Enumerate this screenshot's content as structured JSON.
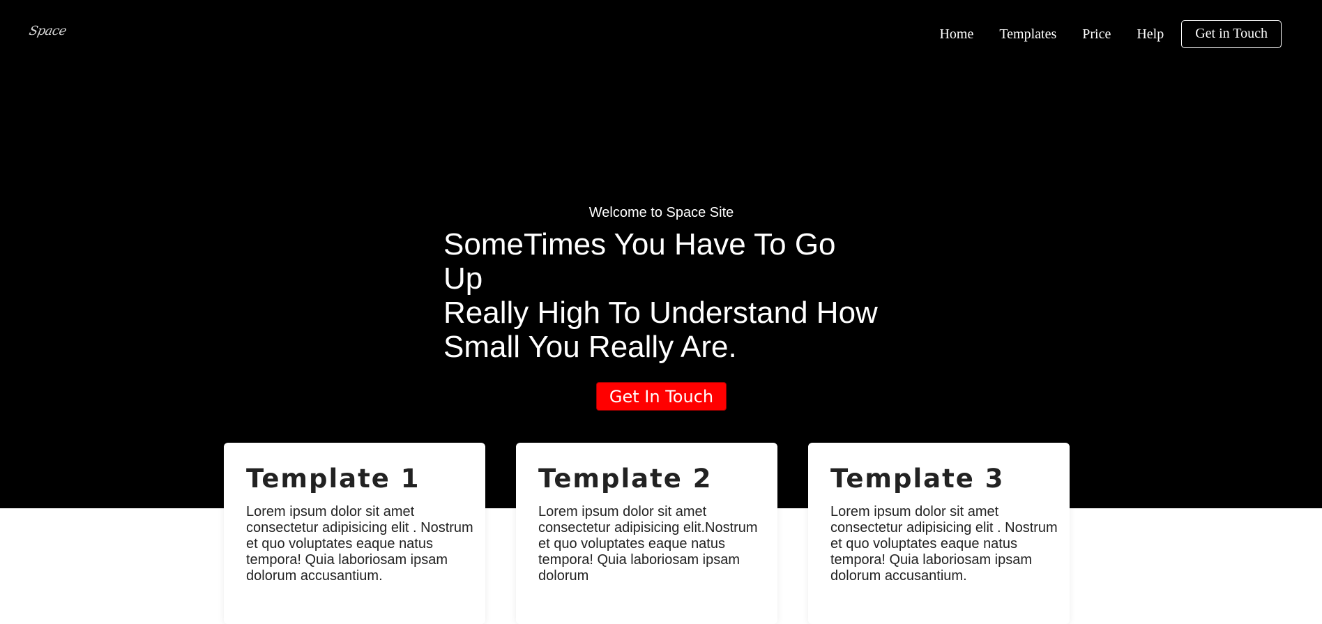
{
  "header": {
    "logo": "Space",
    "nav": {
      "home": "Home",
      "templates": "Templates",
      "price": "Price",
      "help": "Help",
      "get_in_touch": "Get in Touch"
    }
  },
  "hero": {
    "welcome": "Welcome to Space Site",
    "headline_line1": "SomeTimes You Have To Go Up",
    "headline_line2": "Really High To Understand How",
    "headline_line3": "Small You Really Are.",
    "cta": "Get In Touch"
  },
  "cards": [
    {
      "title": "Template 1",
      "text": "Lorem ipsum dolor sit amet consectetur adipisicing elit . Nostrum et quo voluptates eaque natus tempora! Quia laboriosam ipsam dolorum accusantium."
    },
    {
      "title": "Template 2",
      "text": "Lorem ipsum dolor sit amet consectetur adipisicing elit.Nostrum et quo voluptates eaque natus tempora! Quia laboriosam ipsam dolorum"
    },
    {
      "title": "Template 3",
      "text": "Lorem ipsum dolor sit amet consectetur adipisicing elit . Nostrum et quo voluptates eaque natus tempora! Quia laboriosam ipsam dolorum accusantium."
    }
  ],
  "colors": {
    "hero_background": "#000000",
    "cta_background": "#ff0000",
    "page_background": "#ffffff",
    "card_text": "#222222"
  }
}
